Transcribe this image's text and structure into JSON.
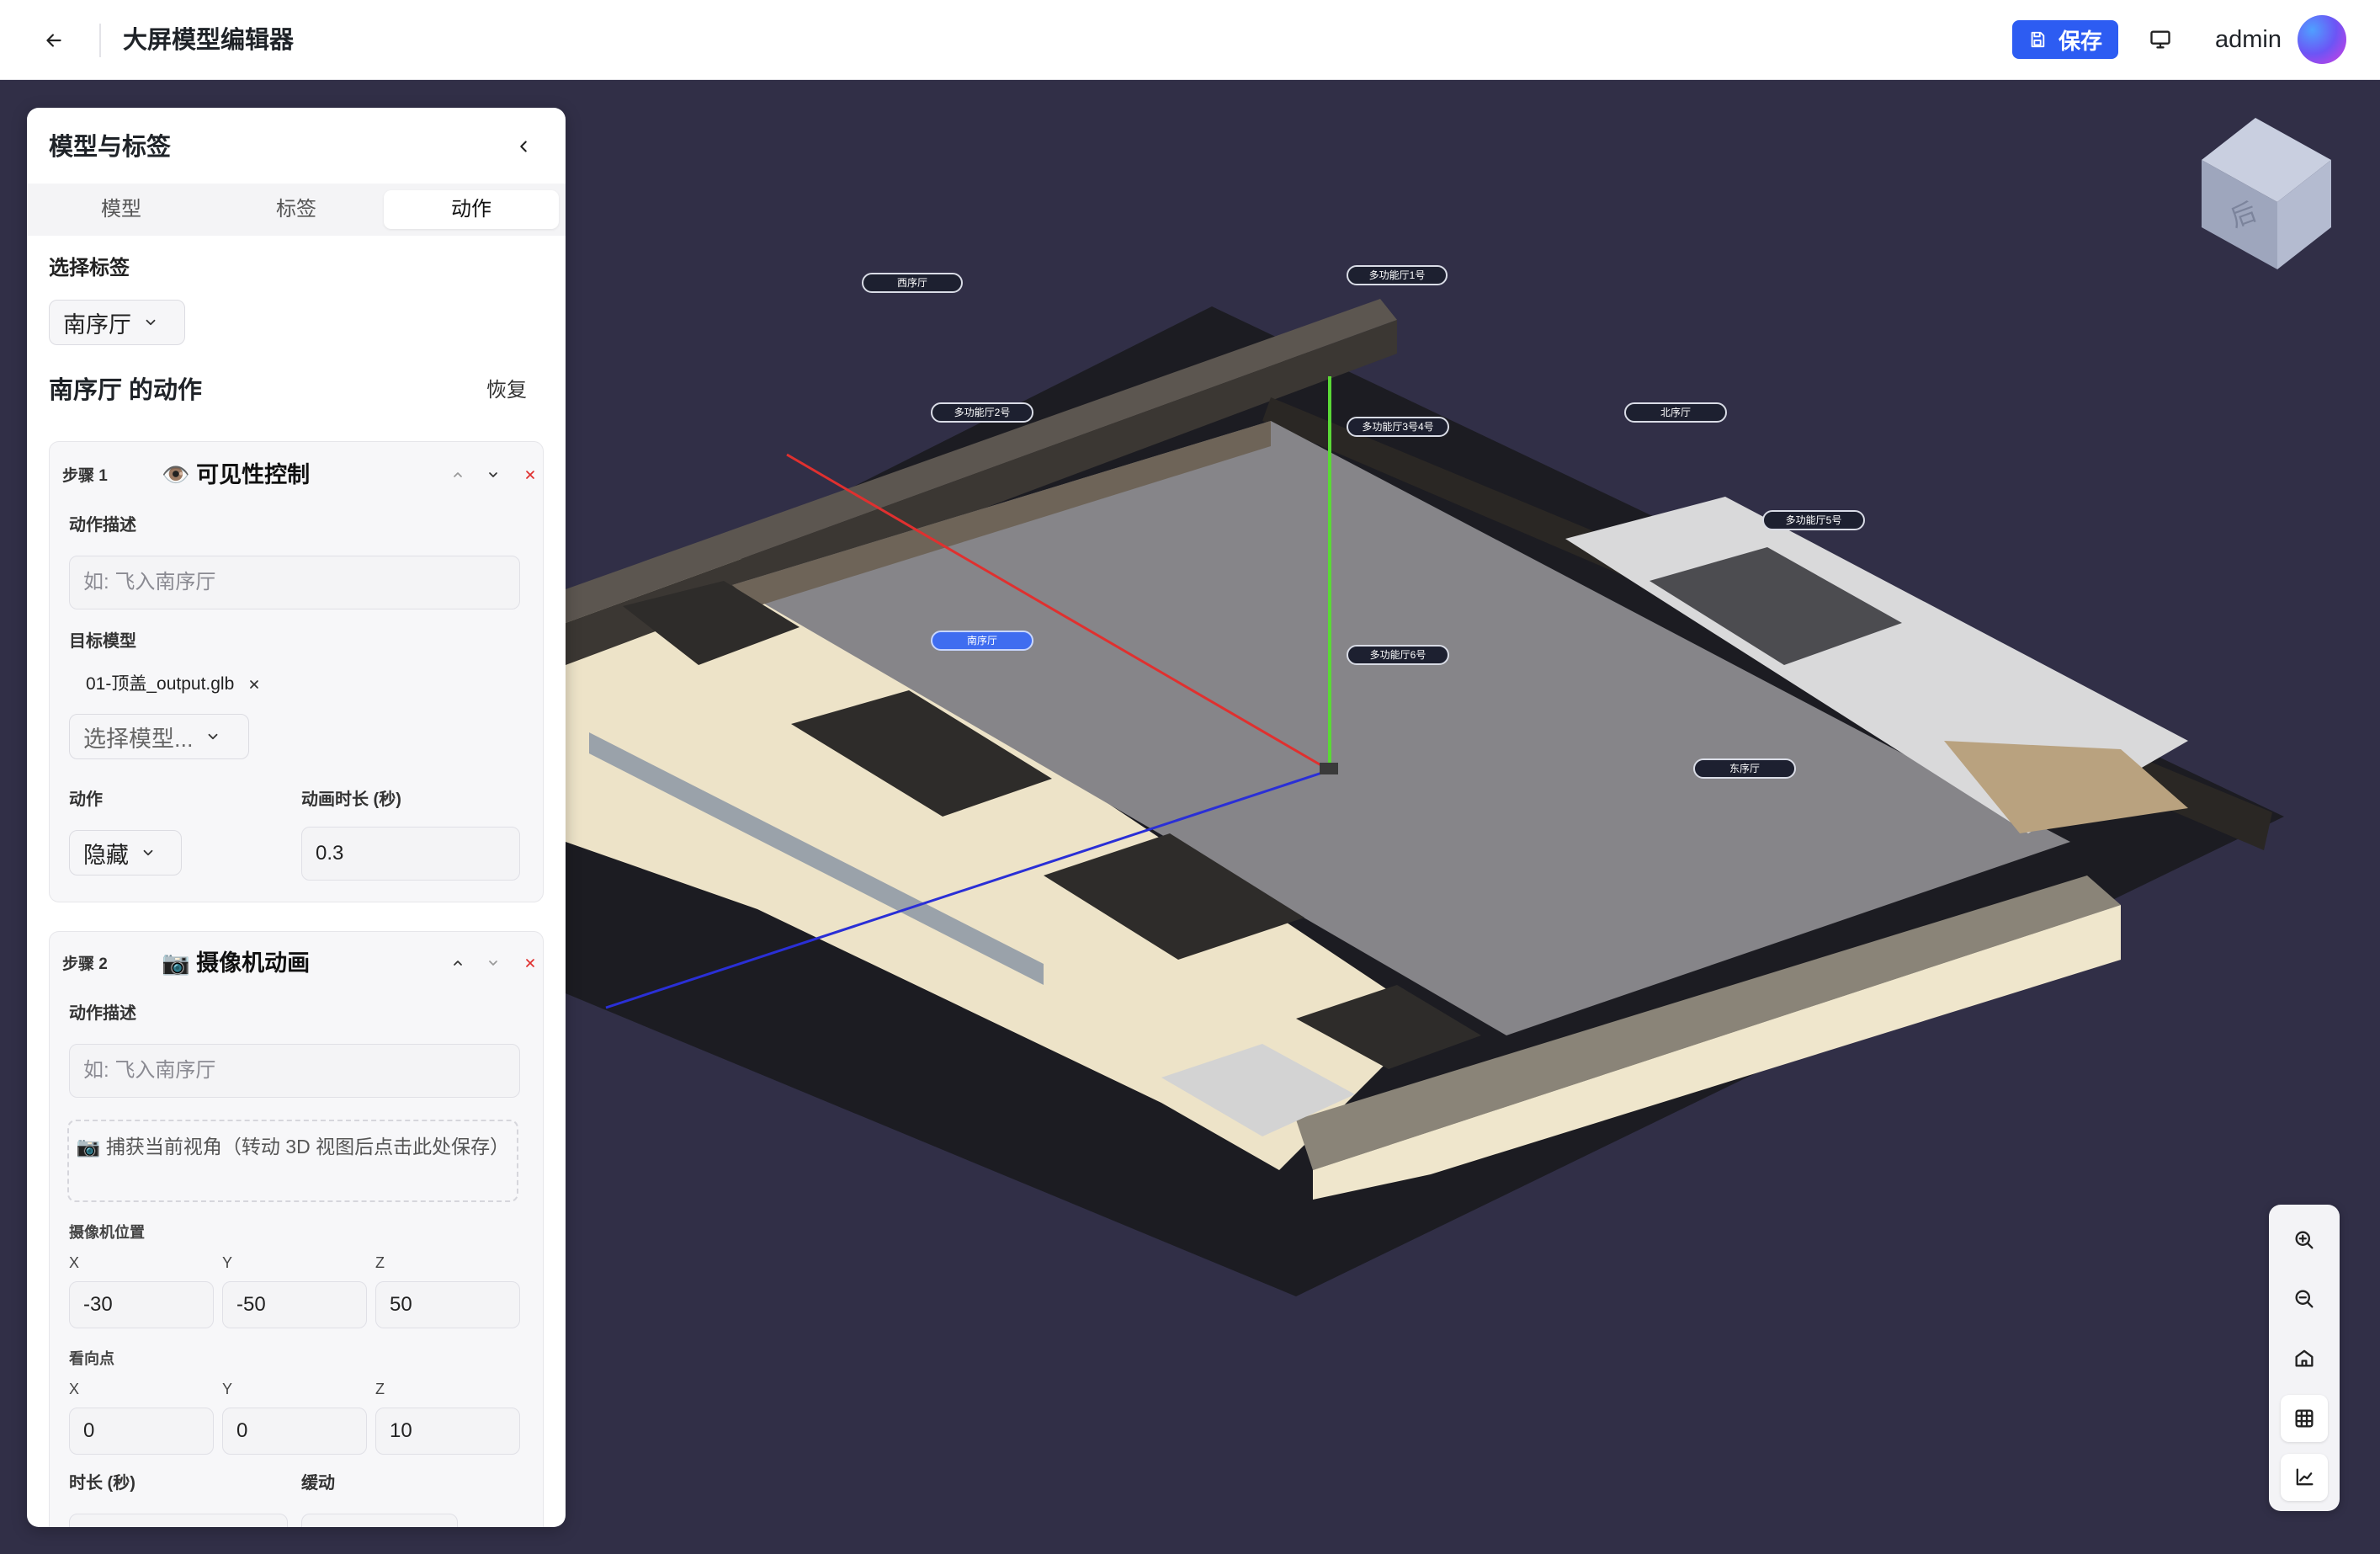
{
  "header": {
    "title": "大屏模型编辑器",
    "save_label": "保存",
    "username": "admin"
  },
  "panel": {
    "title": "模型与标签",
    "tabs": [
      {
        "label": "模型",
        "active": false
      },
      {
        "label": "标签",
        "active": false
      },
      {
        "label": "动作",
        "active": true
      }
    ],
    "select_tag_label": "选择标签",
    "selected_tag": "南序厅",
    "actions_title": "南序厅 的动作",
    "reset_label": "恢复",
    "steps": [
      {
        "step_label": "步骤 1",
        "name": "👁️ 可见性控制",
        "description_label": "动作描述",
        "description_placeholder": "如: 飞入南序厅",
        "target_label": "目标模型",
        "target_chip": "01-顶盖_output.glb",
        "model_select_placeholder": "选择模型...",
        "action_label": "动作",
        "action_value": "隐藏",
        "duration_label": "动画时长 (秒)",
        "duration_value": "0.3"
      },
      {
        "step_label": "步骤 2",
        "name": "📷 摄像机动画",
        "description_label": "动作描述",
        "description_placeholder": "如: 飞入南序厅",
        "capture_text": "📷 捕获当前视角（转动 3D 视图后点击此处保存）",
        "camera_pos_label": "摄像机位置",
        "camera_pos": {
          "x_label": "X",
          "y_label": "Y",
          "z_label": "Z",
          "x": "-30",
          "y": "-50",
          "z": "50"
        },
        "lookat_label": "看向点",
        "lookat": {
          "x_label": "X",
          "y_label": "Y",
          "z_label": "Z",
          "x": "0",
          "y": "0",
          "z": "10"
        },
        "time_label": "时长 (秒)",
        "easing_label": "缓动"
      }
    ]
  },
  "scene": {
    "tags": [
      {
        "text": "西序厅",
        "active": false
      },
      {
        "text": "多功能厅1号",
        "active": false
      },
      {
        "text": "多功能厅2号",
        "active": false
      },
      {
        "text": "多功能厅3号4号",
        "active": false
      },
      {
        "text": "北序厅",
        "active": false
      },
      {
        "text": "多功能厅5号",
        "active": false
      },
      {
        "text": "南序厅",
        "active": true
      },
      {
        "text": "多功能厅6号",
        "active": false
      },
      {
        "text": "东序厅",
        "active": false
      }
    ],
    "view_cube_face": "后"
  },
  "colors": {
    "accent": "#2d5cf2",
    "viewport_bg": "#312f47",
    "axis_x": "#e0302f",
    "axis_y": "#5ad936",
    "axis_z": "#2a2fd6"
  }
}
